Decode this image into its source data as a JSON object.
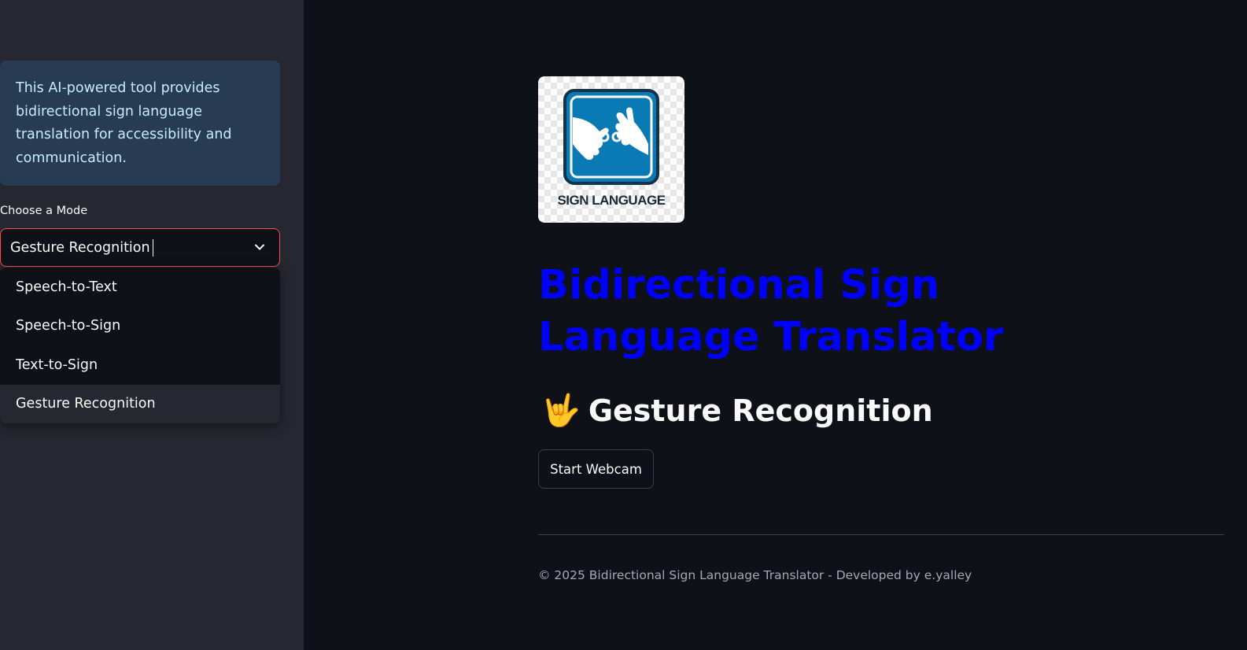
{
  "sidebar": {
    "info_text": "This AI-powered tool provides bidirectional sign language translation for accessibility and communication.",
    "mode_label": "Choose a Mode",
    "selected_mode": "Gesture Recognition",
    "options": [
      {
        "label": "Speech-to-Text"
      },
      {
        "label": "Speech-to-Sign"
      },
      {
        "label": "Text-to-Sign"
      },
      {
        "label": "Gesture Recognition"
      }
    ]
  },
  "main": {
    "logo_text": "SIGN LANGUAGE",
    "title": "Bidirectional Sign Language Translator",
    "section_emoji": "🤟",
    "section_title": "Gesture Recognition",
    "webcam_button_label": "Start Webcam",
    "footer": "© 2025 Bidirectional Sign Language Translator - Developed by e.yalley"
  },
  "colors": {
    "background": "#0e1117",
    "sidebar": "#262730",
    "info_box": "#273b53",
    "title": "#0000ff",
    "select_border": "#ff4b4b"
  },
  "icons": {
    "dropdown": "chevron-down-icon",
    "logo": "sign-language-hands-icon"
  }
}
